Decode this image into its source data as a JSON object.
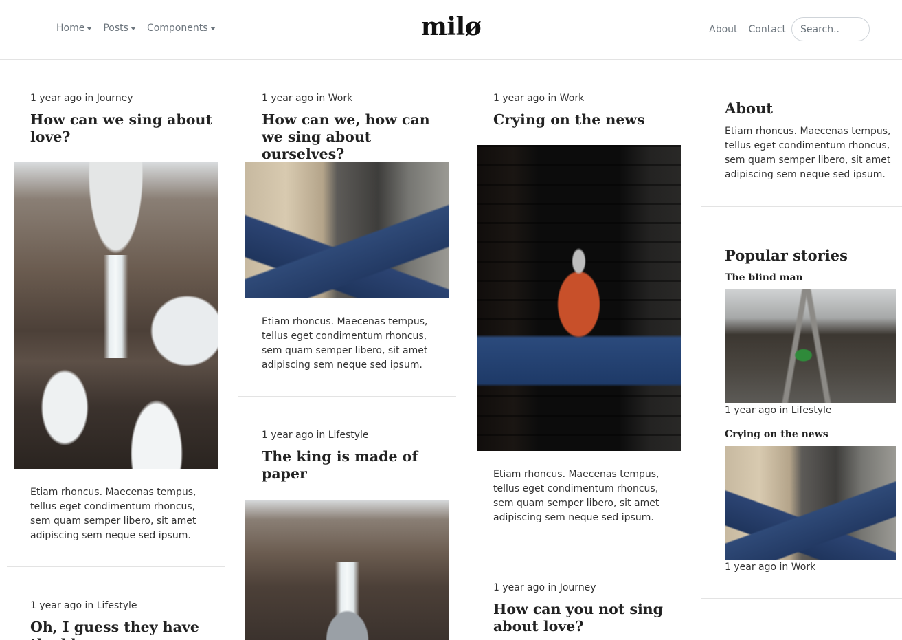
{
  "nav": {
    "left": [
      {
        "label": "Home"
      },
      {
        "label": "Posts"
      },
      {
        "label": "Components"
      }
    ],
    "brand": "milø",
    "right": [
      {
        "label": "About"
      },
      {
        "label": "Contact"
      }
    ],
    "search_placeholder": "Search.."
  },
  "posts": [
    {
      "meta": "1 year ago in Journey",
      "title": "How can we sing about love?",
      "excerpt": "Etiam rhoncus. Maecenas tempus, tellus eget condimentum rhoncus, sem quam semper libero, sit amet adipiscing sem neque sed ipsum."
    },
    {
      "meta": "1 year ago in Lifestyle",
      "title": "Oh, I guess they have the blues"
    },
    {
      "meta": "1 year ago in Work",
      "title": "How can we, how can we sing about ourselves?",
      "excerpt": "Etiam rhoncus. Maecenas tempus, tellus eget condimentum rhoncus, sem quam semper libero, sit amet adipiscing sem neque sed ipsum."
    },
    {
      "meta": "1 year ago in Lifestyle",
      "title": "The king is made of paper"
    },
    {
      "meta": "1 year ago in Work",
      "title": "Crying on the news",
      "excerpt": "Etiam rhoncus. Maecenas tempus, tellus eget condimentum rhoncus, sem quam semper libero, sit amet adipiscing sem neque sed ipsum."
    },
    {
      "meta": "1 year ago in Journey",
      "title": "How can you not sing about love?"
    }
  ],
  "sidebar": {
    "about_heading": "About",
    "about_text": "Etiam rhoncus. Maecenas tempus, tellus eget condimentum rhoncus, sem quam semper libero, sit amet adipiscing sem neque sed ipsum.",
    "popular_heading": "Popular stories",
    "popular": [
      {
        "title": "The blind man",
        "meta": "1 year ago in Lifestyle"
      },
      {
        "title": "Crying on the news",
        "meta": "1 year ago in Work"
      }
    ]
  }
}
